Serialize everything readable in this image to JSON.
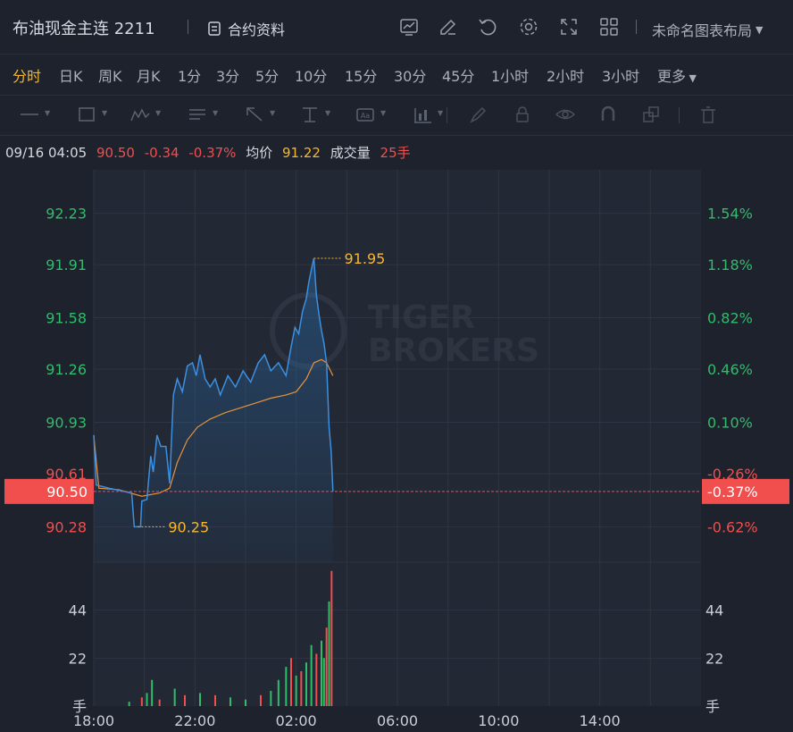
{
  "header": {
    "title": "布油现金主连 2211",
    "contract_info_label": "合约资料",
    "layout_label": "未命名图表布局",
    "tool_icons": [
      "indicator-icon",
      "edit-icon",
      "undo-icon",
      "gear-icon",
      "fullscreen-icon",
      "grid-icon"
    ]
  },
  "periods": {
    "items": [
      "分时",
      "日K",
      "周K",
      "月K",
      "1分",
      "3分",
      "5分",
      "10分",
      "15分",
      "30分",
      "45分",
      "1小时",
      "2小时",
      "3小时",
      "更多"
    ],
    "active": "分时"
  },
  "drawing_tools": [
    "line-tool-icon",
    "rect-tool-icon",
    "wave-tool-icon",
    "text-list-icon",
    "arrow-tool-icon",
    "measure-tool-icon",
    "label-tool-icon",
    "indicator-tool-icon",
    "brush-icon",
    "lock-icon",
    "eye-icon",
    "magnet-icon",
    "copy-icon",
    "trash-icon"
  ],
  "quote": {
    "datetime": "09/16 04:05",
    "price": "90.50",
    "change": "-0.34",
    "change_pct": "-0.37%",
    "avg_label": "均价",
    "avg_value": "91.22",
    "volume_label": "成交量",
    "volume_value": "25手"
  },
  "watermark": {
    "line1": "TIGER",
    "line2": "BROKERS"
  },
  "colors": {
    "up": "#2fbd6a",
    "down": "#f14e4e",
    "price_line": "#3d8fe0",
    "avg_line": "#e8923a",
    "accent": "#f5b731"
  },
  "chart_data": {
    "type": "line",
    "x_ticks": [
      "18:00",
      "22:00",
      "02:00",
      "06:00",
      "10:00",
      "14:00"
    ],
    "price_axis_left": [
      "92.23",
      "91.91",
      "91.58",
      "91.26",
      "90.93",
      "90.61",
      "90.28"
    ],
    "pct_axis_right": [
      "1.54%",
      "1.18%",
      "0.82%",
      "0.46%",
      "0.10%",
      "-0.26%",
      "-0.62%"
    ],
    "ylim": [
      90.06,
      92.5
    ],
    "prev_close": 90.84,
    "current_price_label": "90.50",
    "current_pct_label": "-0.37%",
    "high_label": "91.95",
    "low_label": "90.25",
    "volume_axis": [
      "44",
      "22"
    ],
    "volume_unit": "手",
    "volume_ylim": [
      0,
      66
    ],
    "price_series": [
      [
        18.0,
        90.85
      ],
      [
        18.1,
        90.54
      ],
      [
        18.6,
        90.52
      ],
      [
        19.5,
        90.49
      ],
      [
        19.6,
        90.28
      ],
      [
        19.85,
        90.28
      ],
      [
        19.9,
        90.44
      ],
      [
        20.1,
        90.45
      ],
      [
        20.25,
        90.72
      ],
      [
        20.35,
        90.62
      ],
      [
        20.5,
        90.85
      ],
      [
        20.65,
        90.78
      ],
      [
        20.85,
        90.78
      ],
      [
        21.0,
        90.55
      ],
      [
        21.15,
        91.1
      ],
      [
        21.3,
        91.2
      ],
      [
        21.5,
        91.12
      ],
      [
        21.7,
        91.28
      ],
      [
        21.9,
        91.3
      ],
      [
        22.05,
        91.22
      ],
      [
        22.2,
        91.35
      ],
      [
        22.4,
        91.2
      ],
      [
        22.6,
        91.15
      ],
      [
        22.8,
        91.2
      ],
      [
        23.0,
        91.1
      ],
      [
        23.3,
        91.22
      ],
      [
        23.6,
        91.15
      ],
      [
        23.9,
        91.25
      ],
      [
        24.2,
        91.18
      ],
      [
        24.5,
        91.3
      ],
      [
        24.75,
        91.35
      ],
      [
        25.0,
        91.25
      ],
      [
        25.3,
        91.3
      ],
      [
        25.6,
        91.22
      ],
      [
        25.8,
        91.4
      ],
      [
        25.95,
        91.52
      ],
      [
        26.1,
        91.48
      ],
      [
        26.25,
        91.62
      ],
      [
        26.4,
        91.7
      ],
      [
        26.5,
        91.8
      ],
      [
        26.6,
        91.88
      ],
      [
        26.7,
        91.95
      ],
      [
        26.8,
        91.72
      ],
      [
        26.9,
        91.6
      ],
      [
        27.0,
        91.5
      ],
      [
        27.1,
        91.42
      ],
      [
        27.2,
        91.3
      ],
      [
        27.3,
        90.9
      ],
      [
        27.38,
        90.75
      ],
      [
        27.45,
        90.5
      ]
    ],
    "avg_series": [
      [
        18.0,
        90.85
      ],
      [
        18.2,
        90.52
      ],
      [
        19.0,
        90.51
      ],
      [
        19.9,
        90.47
      ],
      [
        20.6,
        90.49
      ],
      [
        21.0,
        90.52
      ],
      [
        21.3,
        90.68
      ],
      [
        21.7,
        90.82
      ],
      [
        22.1,
        90.9
      ],
      [
        22.6,
        90.95
      ],
      [
        23.2,
        90.99
      ],
      [
        23.8,
        91.02
      ],
      [
        24.4,
        91.05
      ],
      [
        25.0,
        91.08
      ],
      [
        25.6,
        91.1
      ],
      [
        26.0,
        91.12
      ],
      [
        26.4,
        91.2
      ],
      [
        26.7,
        91.3
      ],
      [
        27.0,
        91.32
      ],
      [
        27.2,
        91.3
      ],
      [
        27.45,
        91.22
      ]
    ],
    "volume_bars": [
      [
        19.4,
        2,
        "up"
      ],
      [
        19.9,
        4,
        "down"
      ],
      [
        20.1,
        6,
        "up"
      ],
      [
        20.3,
        12,
        "up"
      ],
      [
        20.6,
        3,
        "down"
      ],
      [
        21.2,
        8,
        "up"
      ],
      [
        21.6,
        5,
        "down"
      ],
      [
        22.2,
        6,
        "up"
      ],
      [
        22.8,
        5,
        "down"
      ],
      [
        23.4,
        4,
        "up"
      ],
      [
        24.0,
        3,
        "up"
      ],
      [
        24.6,
        5,
        "down"
      ],
      [
        25.0,
        7,
        "up"
      ],
      [
        25.3,
        12,
        "up"
      ],
      [
        25.6,
        18,
        "up"
      ],
      [
        25.8,
        22,
        "down"
      ],
      [
        26.0,
        14,
        "up"
      ],
      [
        26.2,
        16,
        "down"
      ],
      [
        26.4,
        20,
        "up"
      ],
      [
        26.6,
        28,
        "up"
      ],
      [
        26.8,
        24,
        "down"
      ],
      [
        27.0,
        30,
        "up"
      ],
      [
        27.1,
        22,
        "up"
      ],
      [
        27.2,
        36,
        "down"
      ],
      [
        27.3,
        48,
        "up"
      ],
      [
        27.4,
        62,
        "down"
      ]
    ]
  }
}
